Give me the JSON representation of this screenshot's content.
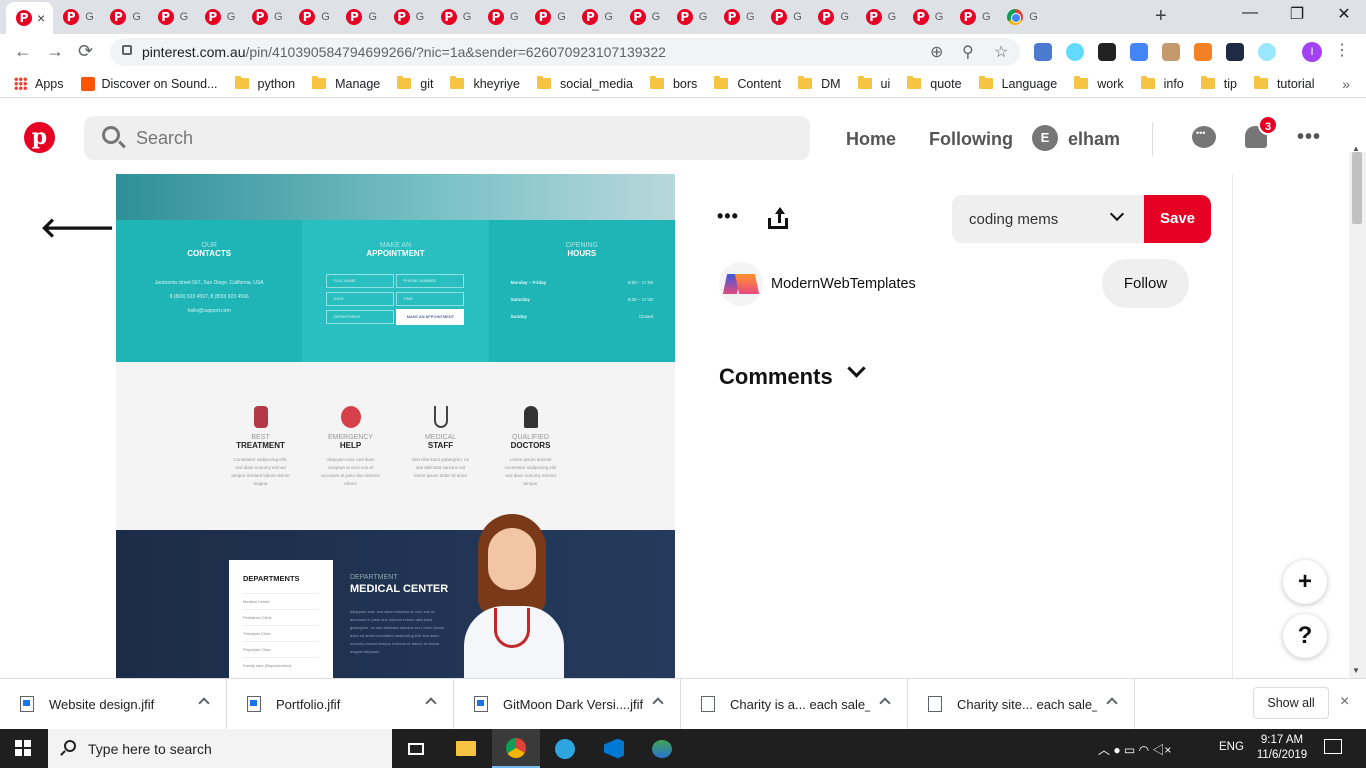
{
  "browser": {
    "active_tab_close": "×",
    "tab_glyph": "G",
    "tab_count": 22,
    "url_host": "pinterest.com.au",
    "url_path": "/pin/410390584794699266/?nic=1a&sender=626070923107139322",
    "profile_initial": "I",
    "bookmarks": [
      "Apps",
      "Discover on Sound...",
      "python",
      "Manage",
      "git",
      "kheyriye",
      "social_media",
      "bors",
      "Content",
      "DM",
      "ui",
      "quote",
      "Language",
      "work",
      "info",
      "tip",
      "tutorial"
    ],
    "bookmarks_more": "»"
  },
  "pinterest": {
    "search_placeholder": "Search",
    "nav_home": "Home",
    "nav_following": "Following",
    "user_initial": "E",
    "user_name": "elham",
    "notification_count": "3",
    "more_glyph": "•••",
    "back_glyph": "🡐",
    "board_name": "coding mems",
    "save_label": "Save",
    "creator_name": "ModernWebTemplates",
    "follow_label": "Follow",
    "comments_label": "Comments",
    "fab_add": "+",
    "fab_help": "?",
    "accent_color": "#e60023"
  },
  "pin_image": {
    "band": [
      {
        "small": "OUR",
        "title": "CONTACTS",
        "lines": [
          "Jacksonia street 567, San Diego, California, USA",
          "8 (800) 923 4567, 8 (800) 923 4566",
          "hello@support.com"
        ]
      },
      {
        "small": "MAKE AN",
        "title": "APPOINTMENT",
        "fields": [
          "FULL NAME",
          "PHONE NUMBER",
          "DATE",
          "TIME",
          "DEPARTMENT"
        ],
        "button": "MAKE AN APPOINTMENT"
      },
      {
        "small": "OPENING",
        "title": "HOURS",
        "rows": [
          [
            "Monday – Friday",
            "8:00 – 17:00"
          ],
          [
            "Saturday",
            "8:30 – 17:30"
          ],
          [
            "Sunday",
            "Closed"
          ]
        ]
      }
    ],
    "services": [
      {
        "small": "BEST",
        "title": "TREATMENT",
        "text": "Consetetur sadipscing elitr, sed diam nonumy eirmod tempor invidunt labore dolore magna"
      },
      {
        "small": "EMERGENCY",
        "title": "HELP",
        "text": "Aliquyam erat, sed diam voluptua at vero eos et accusam et justo duo dolores rebum"
      },
      {
        "small": "MEDICAL",
        "title": "STAFF",
        "text": "Stet clita kasd gubergren, no sea takimata sanctus est lorem ipsum dolor sit amet"
      },
      {
        "small": "QUALIFIED",
        "title": "DOCTORS",
        "text": "Lorem ipsum dolorsit consetetur sadipscing elitr sed diam nonumy eirmod tempor"
      }
    ],
    "dept_box_title": "DEPARTMENTS",
    "dept_items": [
      "Medical Center",
      "Pediatrics Clinic",
      "Therapist Clinic",
      "Physician Clinic",
      "Family care (Reproduction)"
    ],
    "dept_sub": "DEPARTMENT",
    "dept_title": "MEDICAL CENTER",
    "dept_text": "Aliquyam erat, sed diam voluptua at vero eos et accusam et justo duo dolores rebum clita kasd gubergren, no sea takimata sanctus est Lorem ipsum dolor sit amet consetetur sadipscing elitr sed diam nonumy eirmod tempor invidunt ut labore et dolore magna aliquyam"
  },
  "downloads": {
    "items": [
      "Website design.jfif",
      "Portfolio.jfif",
      "GitMoon Dark Versi....jfif",
      "Charity is a... each sale_",
      "Charity site... each sale_"
    ],
    "show_all": "Show all",
    "close": "×"
  },
  "taskbar": {
    "search_placeholder": "Type here to search",
    "lang": "ENG",
    "time": "9:17 AM",
    "date": "11/6/2019"
  }
}
